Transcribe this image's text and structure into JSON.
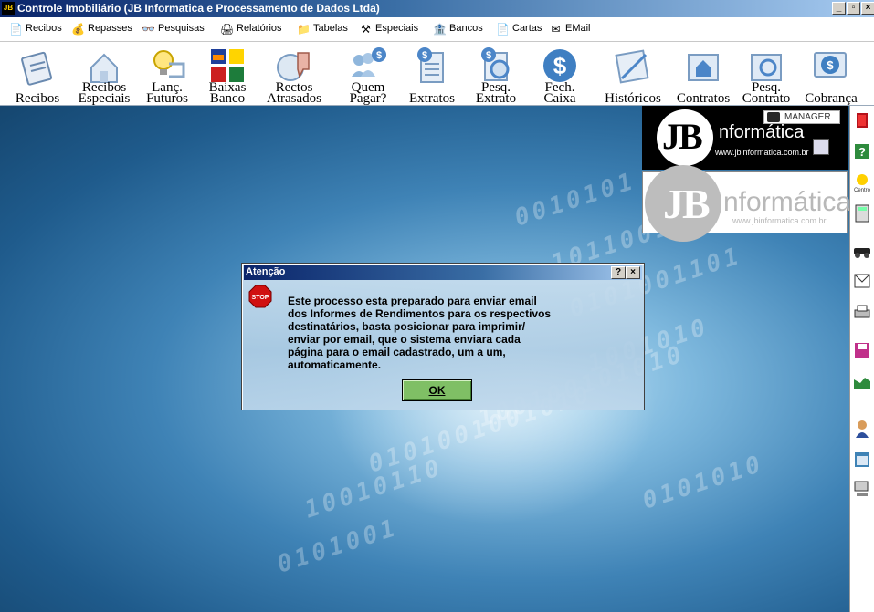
{
  "window": {
    "title": "Controle Imobiliário (JB Informatica e Processamento de Dados Ltda)",
    "app_icon_text": "JB",
    "controls": {
      "minimize": "_",
      "maximize": "▫",
      "close": "×"
    }
  },
  "menu": {
    "items": [
      {
        "label": "Recibos",
        "icon": "document-icon"
      },
      {
        "label": "Repasses",
        "icon": "money-icon"
      },
      {
        "label": "Pesquisas",
        "icon": "binoculars-icon"
      },
      {
        "label": "Relatórios",
        "icon": "printer-icon"
      },
      {
        "label": "Tabelas",
        "icon": "folder-icon"
      },
      {
        "label": "Especiais",
        "icon": "tools-icon"
      },
      {
        "label": "Bancos",
        "icon": "bank-icon"
      },
      {
        "label": "Cartas",
        "icon": "letter-icon"
      },
      {
        "label": "EMail",
        "icon": "email-icon"
      }
    ]
  },
  "toolbar": {
    "buttons": [
      {
        "label": "Recibos"
      },
      {
        "label": "Recibos\nEspeciais"
      },
      {
        "label": "Lanç.\nFuturos"
      },
      {
        "label": "Baixas\nBanco"
      },
      {
        "label": "Rectos\nAtrasados"
      },
      {
        "label": "Quem\nPagar?"
      },
      {
        "label": "Extratos"
      },
      {
        "label": "Pesq.\nExtrato"
      },
      {
        "label": "Fech.\nCaixa"
      },
      {
        "label": "Históricos"
      },
      {
        "label": "Contratos"
      },
      {
        "label": "Pesq.\nContrato"
      },
      {
        "label": "Cobrança"
      }
    ]
  },
  "logo": {
    "brand": "JB",
    "name": "nformática",
    "url": "www.jbinformatica.com.br",
    "user": "MANAGER"
  },
  "sidebar": {
    "icons": [
      "exit-icon",
      "help-icon",
      "center-icon",
      "calculator-icon",
      "car-icon",
      "envelope-icon",
      "printer-icon",
      "save-icon",
      "graph-icon",
      "person-icon",
      "calendar-icon",
      "computer-icon"
    ],
    "center_label": "Centro"
  },
  "dialog": {
    "title": "Atenção",
    "help_button": "?",
    "close_button": "×",
    "stop_label": "STOP",
    "message": "Este processo esta preparado para enviar email\ndos Informes de Rendimentos para os respectivos\ndestinatários, basta posicionar para imprimir/\nenviar por email, que o sistema enviara cada\npágina para o email cadastrado, um a um,\nautomaticamente.",
    "ok_label": "OK"
  },
  "colors": {
    "titlebar": "#0a246a",
    "desktop": "#3f83b6",
    "ok_button": "#7fbf65",
    "stop_red": "#d01010"
  }
}
